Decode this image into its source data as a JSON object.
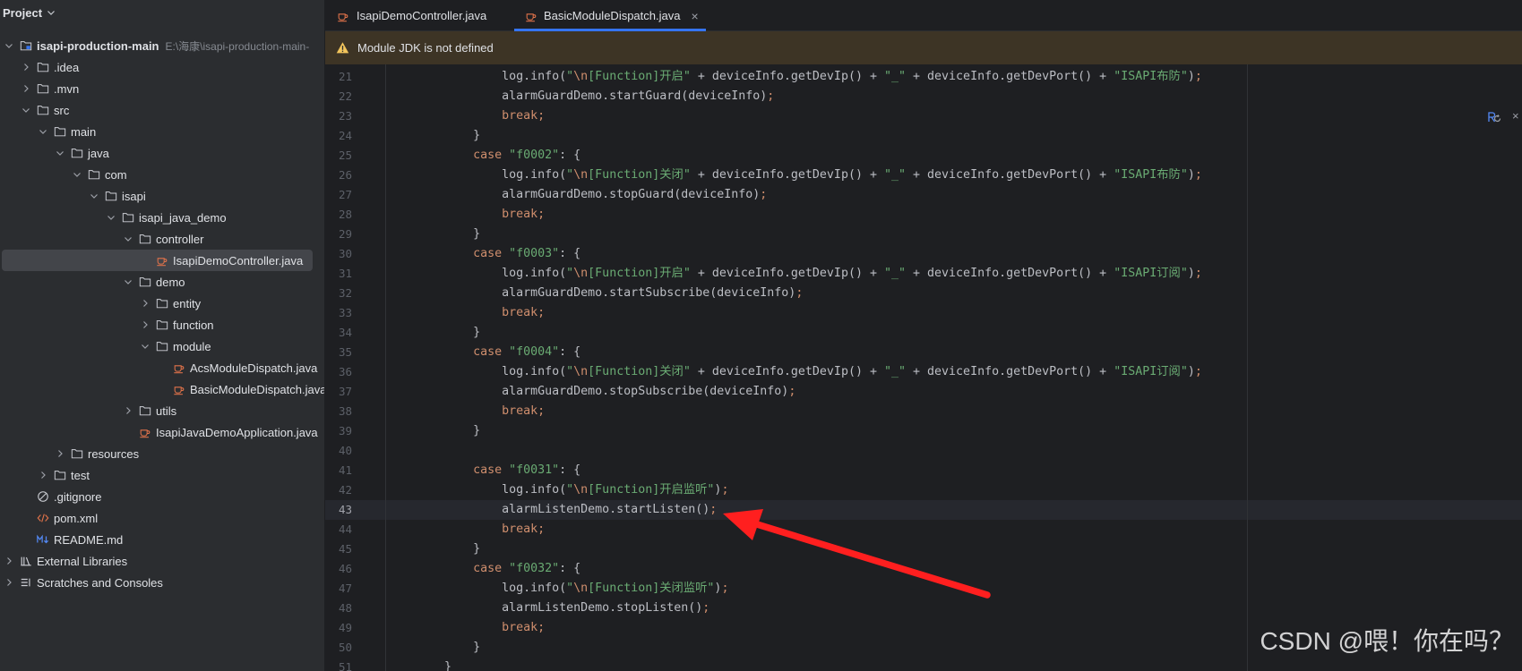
{
  "project_panel": {
    "title": "Project",
    "items": [
      {
        "label": "isapi-production-main",
        "path": "E:\\海康\\isapi-production-main-",
        "depth": 0,
        "kind": "module",
        "state": "expanded",
        "icon": "module-folder-icon"
      },
      {
        "label": ".idea",
        "depth": 1,
        "kind": "folder",
        "state": "collapsed",
        "icon": "folder-icon"
      },
      {
        "label": ".mvn",
        "depth": 1,
        "kind": "folder",
        "state": "collapsed",
        "icon": "folder-icon"
      },
      {
        "label": "src",
        "depth": 1,
        "kind": "folder",
        "state": "expanded",
        "icon": "folder-icon"
      },
      {
        "label": "main",
        "depth": 2,
        "kind": "folder",
        "state": "expanded",
        "icon": "folder-icon"
      },
      {
        "label": "java",
        "depth": 3,
        "kind": "folder",
        "state": "expanded",
        "icon": "folder-icon"
      },
      {
        "label": "com",
        "depth": 4,
        "kind": "folder",
        "state": "expanded",
        "icon": "folder-icon"
      },
      {
        "label": "isapi",
        "depth": 5,
        "kind": "folder",
        "state": "expanded",
        "icon": "folder-icon"
      },
      {
        "label": "isapi_java_demo",
        "depth": 6,
        "kind": "folder",
        "state": "expanded",
        "icon": "folder-icon"
      },
      {
        "label": "controller",
        "depth": 7,
        "kind": "folder",
        "state": "expanded",
        "icon": "folder-icon"
      },
      {
        "label": "IsapiDemoController.java",
        "depth": 8,
        "kind": "file",
        "icon": "java-file-icon",
        "selected": true
      },
      {
        "label": "demo",
        "depth": 7,
        "kind": "folder",
        "state": "expanded",
        "icon": "folder-icon"
      },
      {
        "label": "entity",
        "depth": 8,
        "kind": "folder",
        "state": "collapsed",
        "icon": "folder-icon"
      },
      {
        "label": "function",
        "depth": 8,
        "kind": "folder",
        "state": "collapsed",
        "icon": "folder-icon"
      },
      {
        "label": "module",
        "depth": 8,
        "kind": "folder",
        "state": "expanded",
        "icon": "folder-icon"
      },
      {
        "label": "AcsModuleDispatch.java",
        "depth": 9,
        "kind": "file",
        "icon": "java-file-icon"
      },
      {
        "label": "BasicModuleDispatch.java",
        "depth": 9,
        "kind": "file",
        "icon": "java-file-icon"
      },
      {
        "label": "utils",
        "depth": 7,
        "kind": "folder",
        "state": "collapsed",
        "icon": "folder-icon"
      },
      {
        "label": "IsapiJavaDemoApplication.java",
        "depth": 7,
        "kind": "file",
        "icon": "java-file-icon"
      },
      {
        "label": "resources",
        "depth": 3,
        "kind": "folder",
        "state": "collapsed",
        "icon": "folder-icon"
      },
      {
        "label": "test",
        "depth": 2,
        "kind": "folder",
        "state": "collapsed",
        "icon": "folder-icon"
      },
      {
        "label": ".gitignore",
        "depth": 1,
        "kind": "file",
        "icon": "gitignore-icon"
      },
      {
        "label": "pom.xml",
        "depth": 1,
        "kind": "file",
        "icon": "xml-file-icon"
      },
      {
        "label": "README.md",
        "depth": 1,
        "kind": "file",
        "icon": "markdown-file-icon"
      },
      {
        "label": "External Libraries",
        "depth": 0,
        "kind": "node",
        "state": "collapsed",
        "icon": "external-libraries-icon"
      },
      {
        "label": "Scratches and Consoles",
        "depth": 0,
        "kind": "node",
        "state": "collapsed",
        "icon": "scratches-icon"
      }
    ]
  },
  "tabs": [
    {
      "label": "IsapiDemoController.java",
      "icon": "java-file-icon",
      "active": false
    },
    {
      "label": "BasicModuleDispatch.java",
      "icon": "java-file-icon",
      "active": true,
      "close_label": "×"
    }
  ],
  "notification": {
    "icon": "warning-icon",
    "text": "Module JDK is not defined"
  },
  "editor": {
    "current_line": 43,
    "lines": [
      {
        "n": 21,
        "code": "                log.info(\"\\n[Function]开启\" + deviceInfo.getDevIp() + \"_\" + deviceInfo.getDevPort() + \"ISAPI布防\");"
      },
      {
        "n": 22,
        "code": "                alarmGuardDemo.startGuard(deviceInfo);"
      },
      {
        "n": 23,
        "code": "                break;"
      },
      {
        "n": 24,
        "code": "            }"
      },
      {
        "n": 25,
        "code": "            case \"f0002\": {"
      },
      {
        "n": 26,
        "code": "                log.info(\"\\n[Function]关闭\" + deviceInfo.getDevIp() + \"_\" + deviceInfo.getDevPort() + \"ISAPI布防\");"
      },
      {
        "n": 27,
        "code": "                alarmGuardDemo.stopGuard(deviceInfo);"
      },
      {
        "n": 28,
        "code": "                break;"
      },
      {
        "n": 29,
        "code": "            }"
      },
      {
        "n": 30,
        "code": "            case \"f0003\": {"
      },
      {
        "n": 31,
        "code": "                log.info(\"\\n[Function]开启\" + deviceInfo.getDevIp() + \"_\" + deviceInfo.getDevPort() + \"ISAPI订阅\");"
      },
      {
        "n": 32,
        "code": "                alarmGuardDemo.startSubscribe(deviceInfo);"
      },
      {
        "n": 33,
        "code": "                break;"
      },
      {
        "n": 34,
        "code": "            }"
      },
      {
        "n": 35,
        "code": "            case \"f0004\": {"
      },
      {
        "n": 36,
        "code": "                log.info(\"\\n[Function]关闭\" + deviceInfo.getDevIp() + \"_\" + deviceInfo.getDevPort() + \"ISAPI订阅\");"
      },
      {
        "n": 37,
        "code": "                alarmGuardDemo.stopSubscribe(deviceInfo);"
      },
      {
        "n": 38,
        "code": "                break;"
      },
      {
        "n": 39,
        "code": "            }"
      },
      {
        "n": 40,
        "code": ""
      },
      {
        "n": 41,
        "code": "            case \"f0031\": {"
      },
      {
        "n": 42,
        "code": "                log.info(\"\\n[Function]开启监听\");"
      },
      {
        "n": 43,
        "code": "                alarmListenDemo.startListen();"
      },
      {
        "n": 44,
        "code": "                break;"
      },
      {
        "n": 45,
        "code": "            }"
      },
      {
        "n": 46,
        "code": "            case \"f0032\": {"
      },
      {
        "n": 47,
        "code": "                log.info(\"\\n[Function]关闭监听\");"
      },
      {
        "n": 48,
        "code": "                alarmListenDemo.stopListen();"
      },
      {
        "n": 49,
        "code": "                break;"
      },
      {
        "n": 50,
        "code": "            }"
      },
      {
        "n": 51,
        "code": "        }"
      }
    ],
    "keywords": [
      "case",
      "break"
    ]
  },
  "editor_corner": {
    "icon": "reader-mode-icon",
    "close_label": "×"
  },
  "watermark": "CSDN @喂！你在吗？",
  "colors": {
    "accent": "#3574f0",
    "keyword": "#cf8e6d",
    "string": "#6aab73",
    "text": "#bcbec4",
    "warning": "#f2c55c",
    "annotation_arrow": "#ff1f1f",
    "selection": "#43454a"
  }
}
